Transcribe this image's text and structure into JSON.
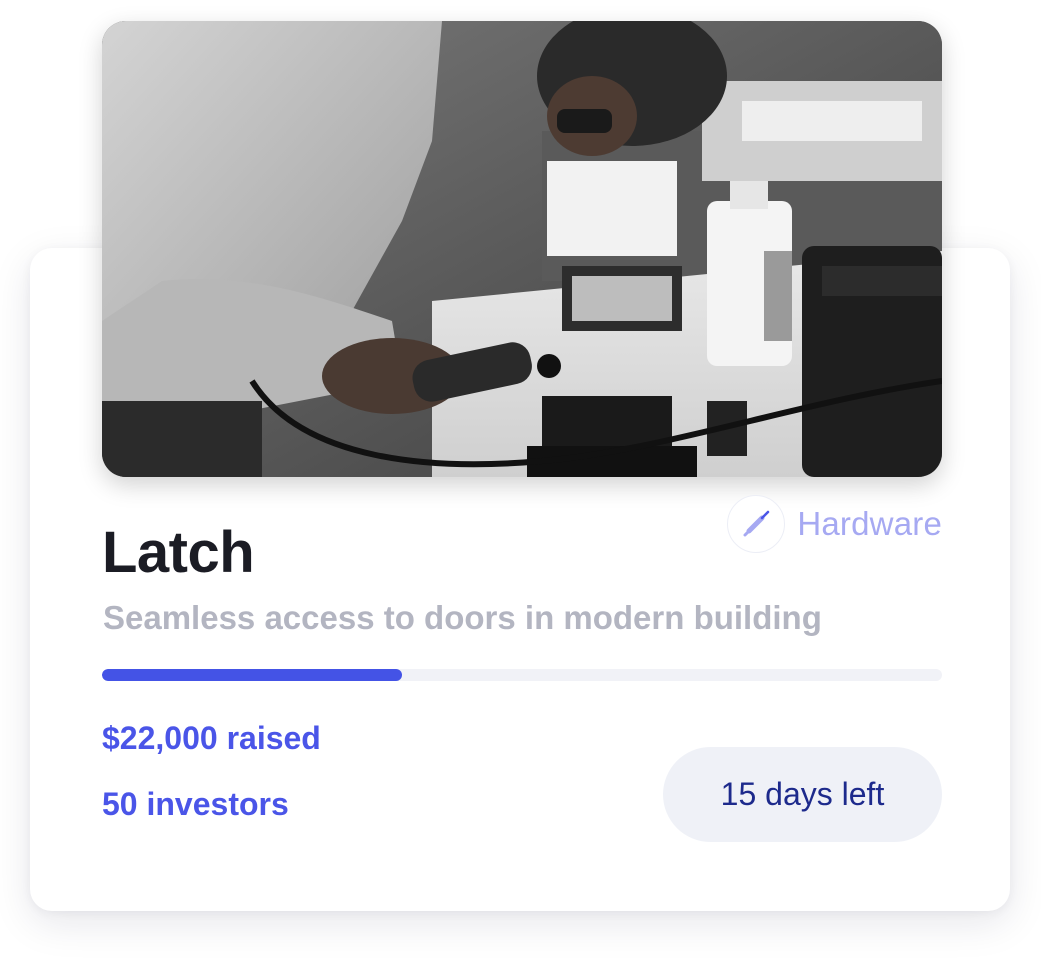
{
  "project": {
    "title": "Latch",
    "description": "Seamless access to doors in modern building",
    "category": {
      "label": "Hardware",
      "icon": "screwdriver-icon",
      "color": "#a6a9f2"
    },
    "funding": {
      "raised_label": "$22,000 raised",
      "investors_label": "50 investors",
      "progress_fraction": 0.357,
      "accent_color": "#4453e6"
    },
    "days_left_label": "15 days left"
  }
}
